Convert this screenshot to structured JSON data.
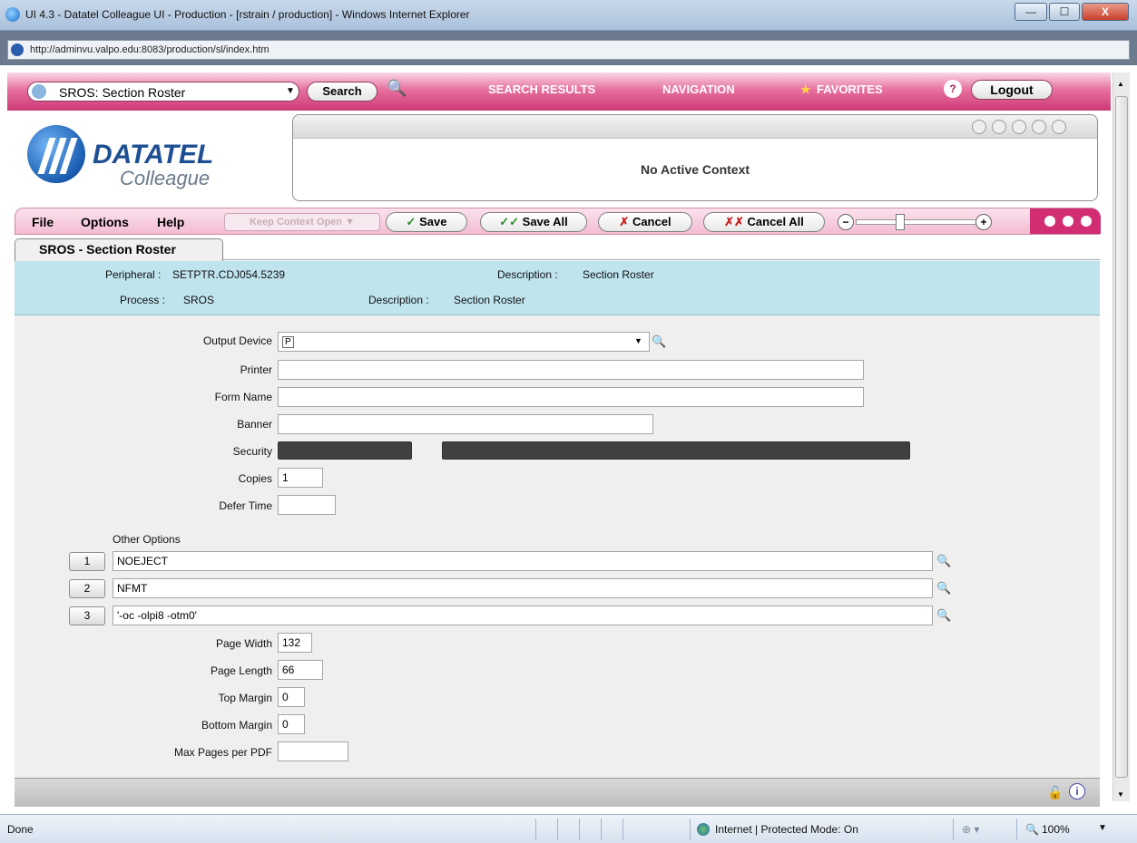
{
  "window": {
    "title": "UI 4.3 - Datatel Colleague UI - Production - [rstrain / production] - Windows Internet Explorer",
    "minimize": "—",
    "maximize": "☐",
    "close": "X"
  },
  "address": {
    "url": "http://adminvu.valpo.edu:8083/production/sl/index.htm"
  },
  "topnav": {
    "screen_select_value": "SROS: Section Roster",
    "search_label": "Search",
    "search_results": "SEARCH RESULTS",
    "navigation": "NAVIGATION",
    "favorites": "FAVORITES",
    "help": "?",
    "logout": "Logout"
  },
  "logo": {
    "line1": "DATATEL",
    "line2": "Colleague"
  },
  "context": {
    "message": "No Active Context"
  },
  "menubar": {
    "file": "File",
    "options": "Options",
    "help": "Help",
    "keep_context": "Keep Context Open",
    "save": "Save",
    "save_all": "Save All",
    "cancel": "Cancel",
    "cancel_all": "Cancel All",
    "zoom_out": "−",
    "zoom_in": "+"
  },
  "tab": {
    "label": "SROS - Section Roster"
  },
  "info": {
    "peripheral_label": "Peripheral :",
    "peripheral_value": "SETPTR.CDJ054.5239",
    "desc1_label": "Description :",
    "desc1_value": "Section Roster",
    "process_label": "Process :",
    "process_value": "SROS",
    "desc2_label": "Description :",
    "desc2_value": "Section Roster"
  },
  "form": {
    "output_device_label": "Output Device",
    "output_device_value": "P",
    "printer_label": "Printer",
    "printer_value": "",
    "form_name_label": "Form Name",
    "form_name_value": "",
    "banner_label": "Banner",
    "banner_value": "",
    "security_label": "Security",
    "copies_label": "Copies",
    "copies_value": "1",
    "defer_time_label": "Defer Time",
    "defer_time_value": "",
    "other_options_label": "Other Options",
    "other_options": [
      {
        "num": "1",
        "value": "NOEJECT"
      },
      {
        "num": "2",
        "value": "NFMT"
      },
      {
        "num": "3",
        "value": "'-oc -olpi8 -otm0'"
      }
    ],
    "page_width_label": "Page Width",
    "page_width_value": "132",
    "page_length_label": "Page Length",
    "page_length_value": "66",
    "top_margin_label": "Top Margin",
    "top_margin_value": "0",
    "bottom_margin_label": "Bottom Margin",
    "bottom_margin_value": "0",
    "max_pages_label": "Max Pages per PDF",
    "max_pages_value": ""
  },
  "status": {
    "left": "Done",
    "zone": "Internet | Protected Mode: On",
    "zoom": "100%"
  }
}
